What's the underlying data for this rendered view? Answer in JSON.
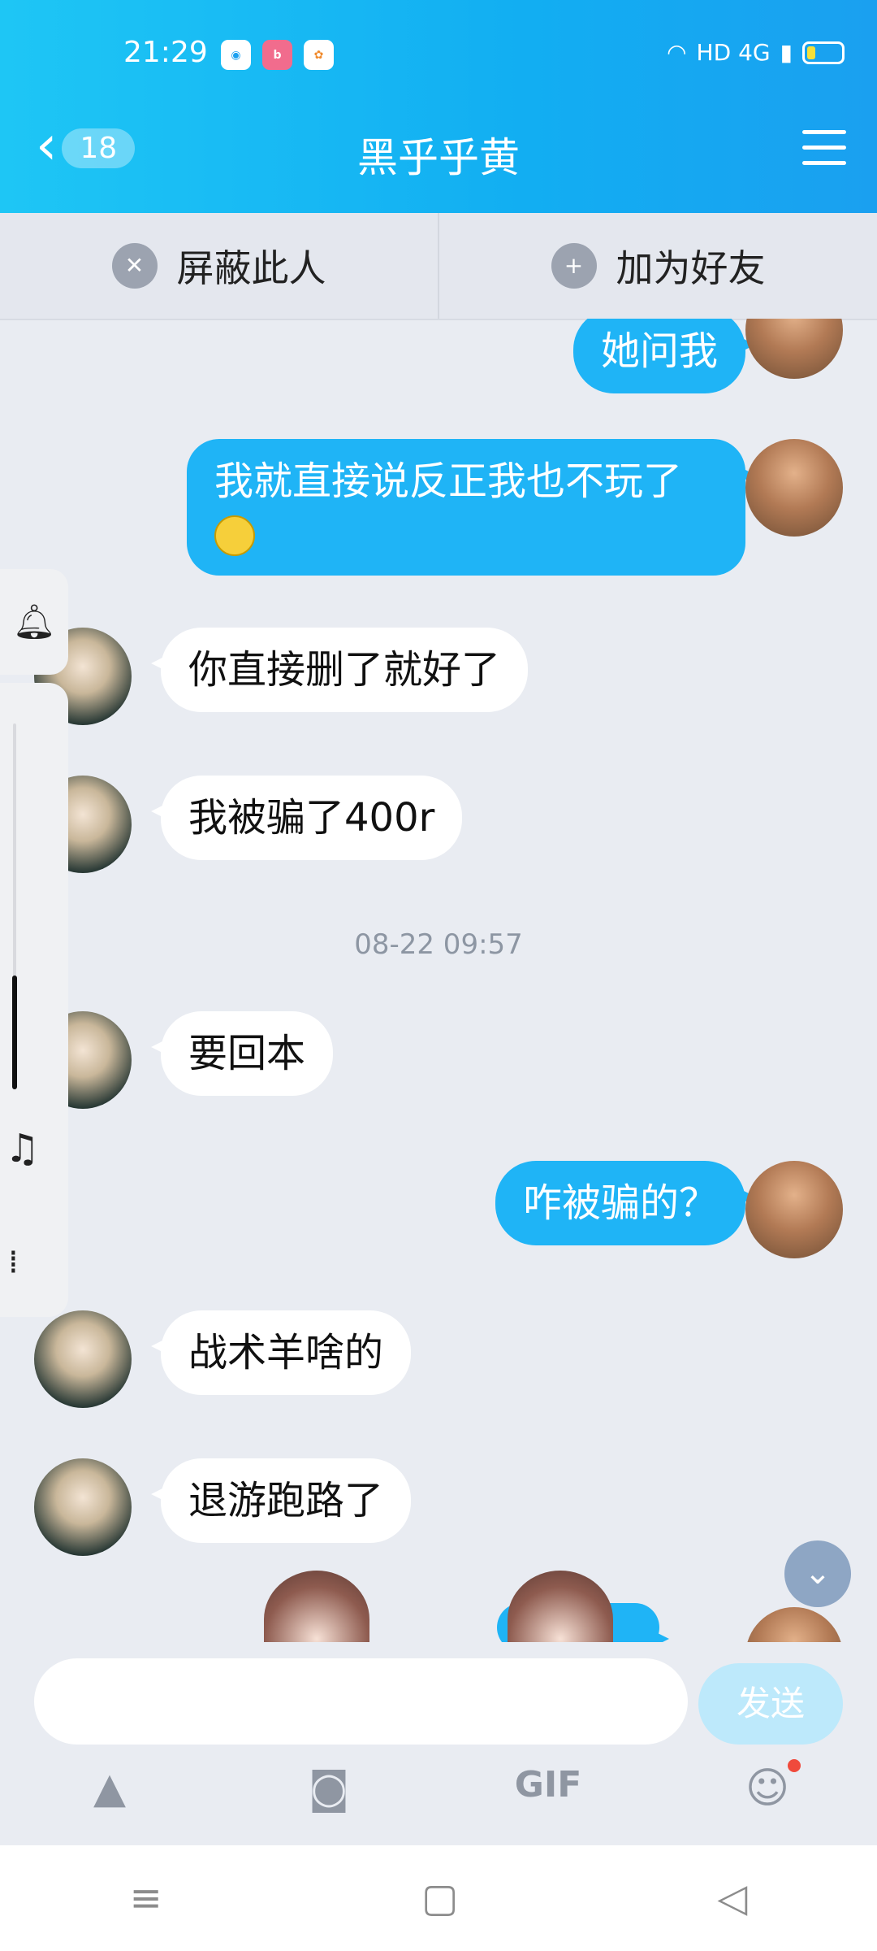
{
  "status": {
    "time": "21:29",
    "apps": [
      "app1",
      "bili",
      "gallery"
    ],
    "right_text": "HD 4G"
  },
  "header": {
    "unread_count": "18",
    "title": "黑乎乎黄"
  },
  "actions": {
    "block": "屏蔽此人",
    "add_friend": "加为好友"
  },
  "messages": [
    {
      "side": "me",
      "text": "她问我"
    },
    {
      "side": "me",
      "text": "我就直接说反正我也不玩了"
    },
    {
      "side": "them",
      "text": "你直接删了就好了"
    },
    {
      "side": "them",
      "text": "我被骗了400r"
    },
    {
      "side": "them",
      "text": "要回本"
    },
    {
      "side": "me",
      "text": "咋被骗的？"
    },
    {
      "side": "them",
      "text": "战术羊啥的"
    },
    {
      "side": "them",
      "text": "退游跑路了"
    }
  ],
  "timestamp": "08-22 09:57",
  "input": {
    "value": "",
    "send_label": "发送"
  },
  "tools": {
    "gif_label": "GIF"
  },
  "colors": {
    "header_blue": "#12aef2",
    "my_bubble": "#1fb4f6",
    "their_bubble": "#ffffff",
    "send_disabled": "#bde9fb"
  }
}
